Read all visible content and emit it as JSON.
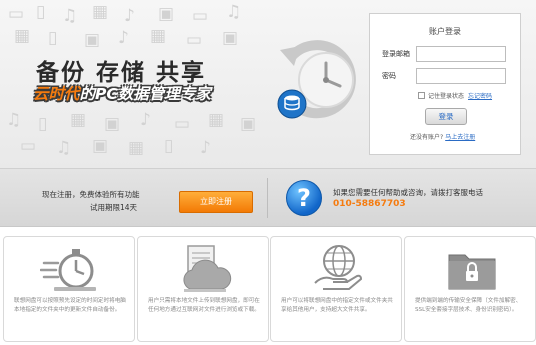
{
  "hero": {
    "headline": "备份  存储  共享",
    "subline_accent": "云时代",
    "subline_rest": "的PC数据管理专家"
  },
  "login": {
    "title": "账户登录",
    "email_label": "登录邮箱",
    "email_value": "",
    "password_label": "密码",
    "password_value": "",
    "remember_label": "记住登录状态",
    "forgot_link": "忘记密码",
    "submit_label": "登录",
    "register_prompt": "还没有账户?",
    "register_link": "马上去注册"
  },
  "promo": {
    "line1": "现在注册，免费体验所有功能",
    "line2": "试用期限14天",
    "register_button": "立即注册",
    "help_text": "如果您需要任何帮助或咨询，请拨打客服电话",
    "phone": "010-58867703"
  },
  "features": [
    {
      "icon": "stopwatch-icon",
      "text": "联想网盘可以按照预先设定的时间定时将电脑本地指定的文件夹中的更新文件自动备份。"
    },
    {
      "icon": "cloud-upload-icon",
      "text": "用户只需将本地文件上传到联想网盘，即可在任何地方通过互联网对文件进行浏览或下载。"
    },
    {
      "icon": "globe-share-icon",
      "text": "用户可以将联想网盘中的指定文件或文件夹共享给其他用户，支持超大文件共享。"
    },
    {
      "icon": "lock-folder-icon",
      "text": "提供端到端的传输安全保障（文件加解密、SSL安全套接字层技术、身份识别密码）。"
    }
  ],
  "colors": {
    "accent_orange": "#f57b0f",
    "link_blue": "#2a6bc4",
    "help_blue": "#1166c9"
  }
}
